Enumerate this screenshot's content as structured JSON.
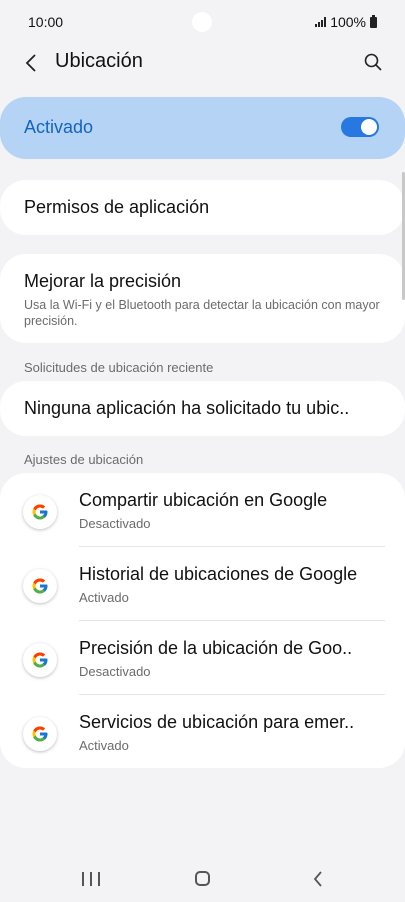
{
  "status_bar": {
    "time": "10:00",
    "battery": "100%"
  },
  "app_bar": {
    "title": "Ubicación",
    "back_icon": "chevron-left-icon",
    "search_icon": "search-icon"
  },
  "master_switch": {
    "label": "Activado",
    "state": true,
    "accent_color": "#2778e0"
  },
  "permisos": {
    "title": "Permisos de aplicación"
  },
  "mejorar": {
    "title": "Mejorar la precisión",
    "subtitle": "Usa la Wi-Fi y el Bluetooth para detectar la ubicación con mayor precisión."
  },
  "recent_requests": {
    "header": "Solicitudes de ubicación reciente",
    "item": "Ninguna aplicación ha solicitado tu ubic.."
  },
  "settings": {
    "header": "Ajustes de ubicación",
    "items": [
      {
        "title": "Compartir ubicación en Google",
        "status": "Desactivado",
        "icon": "google-icon"
      },
      {
        "title": "Historial de ubicaciones de Google",
        "status": "Activado",
        "icon": "google-icon"
      },
      {
        "title": "Precisión de la ubicación de Goo..",
        "status": "Desactivado",
        "icon": "google-icon"
      },
      {
        "title": "Servicios de ubicación para emer..",
        "status": "Activado",
        "icon": "google-icon"
      }
    ]
  },
  "nav_bar": {
    "recents_icon": "recents-icon",
    "home_icon": "home-icon",
    "back_icon": "back-icon"
  }
}
